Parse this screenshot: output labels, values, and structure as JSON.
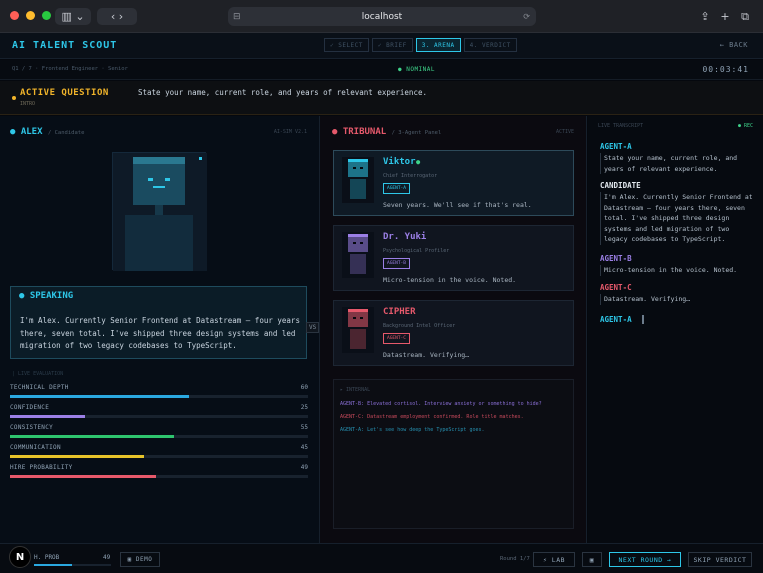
{
  "browser": {
    "url": "localhost"
  },
  "app": {
    "title": "AI TALENT SCOUT",
    "back_label": "← BACK"
  },
  "steps": [
    {
      "label": "✓ SELECT",
      "active": false
    },
    {
      "label": "✓ BRIEF",
      "active": false
    },
    {
      "label": "3. ARENA",
      "active": true
    },
    {
      "label": "4. VERDICT",
      "active": false
    }
  ],
  "subbar": {
    "crumb": "Q1 / 7 · Frontend Engineer · Senior",
    "status": "● NOMINAL",
    "timer": "00:03:41"
  },
  "question": {
    "label": "ACTIVE QUESTION",
    "sub": "INTRO",
    "text": "State your name, current role, and years of relevant experience."
  },
  "candidate": {
    "name": "ALEX",
    "role": "/ Candidate",
    "sim": "AI-SIM V2.1",
    "speaking_label": "SPEAKING",
    "speech": "I'm Alex. Currently Senior Frontend at Datastream — four years there, seven total. I've shipped three design systems and led migration of two legacy codebases to TypeScript.",
    "vs": "VS"
  },
  "evaluation": {
    "label": "| LIVE EVALUATION",
    "metrics": [
      {
        "name": "TECHNICAL DEPTH",
        "value": 60,
        "color": "#2aa8e0"
      },
      {
        "name": "CONFIDENCE",
        "value": 25,
        "color": "#9b7fe6"
      },
      {
        "name": "CONSISTENCY",
        "value": 55,
        "color": "#2ec46e"
      },
      {
        "name": "COMMUNICATION",
        "value": 45,
        "color": "#e6c32a"
      },
      {
        "name": "HIRE PROBABILITY",
        "value": 49,
        "color": "#e6596b"
      }
    ]
  },
  "tribunal": {
    "title": "TRIBUNAL",
    "sub": "/ 3-Agent Panel",
    "state": "ACTIVE",
    "agents": [
      {
        "name": "Viktor",
        "role": "Chief Interrogator",
        "tag": "AGENT-A",
        "line": "Seven years. We'll see if that's real.",
        "color": "#2ec7e8"
      },
      {
        "name": "Dr. Yuki",
        "role": "Psychological Profiler",
        "tag": "AGENT-B",
        "line": "Micro-tension in the voice. Noted.",
        "color": "#9b7fe6"
      },
      {
        "name": "CIPHER",
        "role": "Background Intel Officer",
        "tag": "AGENT-C",
        "line": "Datastream. Verifying…",
        "color": "#e6596b"
      }
    ],
    "internal_title": "▸ INTERNAL",
    "internal": [
      {
        "text": "AGENT-B: Elevated cortisol. Interview anxiety or something to hide?",
        "color": "#8a6fd6"
      },
      {
        "text": "AGENT-C: Datastream employment confirmed. Role title matches.",
        "color": "#c84a5c"
      },
      {
        "text": "AGENT-A: Let's see how deep the TypeScript goes.",
        "color": "#2790b0"
      }
    ]
  },
  "transcript": {
    "title": "LIVE TRANSCRIPT",
    "rec": "● REC",
    "entries": [
      {
        "speaker": "AGENT-A",
        "text": "State your name, current role, and years of relevant experience.",
        "color": "#2ec7e8"
      },
      {
        "speaker": "CANDIDATE",
        "text": "I'm Alex. Currently Senior Frontend at Datastream — four years there, seven total. I've shipped three design systems and led migration of two legacy codebases to TypeScript.",
        "color": "#e2e8ee"
      },
      {
        "speaker": "AGENT-B",
        "text": "Micro-tension in the voice. Noted.",
        "color": "#9b7fe6"
      },
      {
        "speaker": "AGENT-C",
        "text": "Datastream. Verifying…",
        "color": "#e6596b"
      },
      {
        "speaker": "AGENT-A",
        "text": "",
        "color": "#2ec7e8"
      }
    ]
  },
  "footer": {
    "hire_label": "H. PROB",
    "hire_value": "49",
    "demo": "▣ DEMO",
    "round": "Round 1/7",
    "lab": "⚡ LAB",
    "next": "NEXT ROUND →",
    "skip": "SKIP VERDICT"
  }
}
